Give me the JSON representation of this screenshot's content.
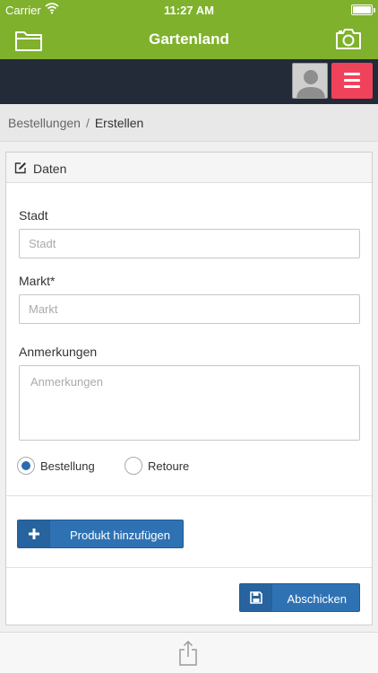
{
  "status_bar": {
    "carrier": "Carrier",
    "time": "11:27 AM",
    "battery_level": 1.0
  },
  "nav": {
    "title": "Gartenland",
    "left_icon": "folder-icon",
    "right_icon": "camera-icon"
  },
  "header": {
    "avatar_icon": "avatar-placeholder-icon",
    "menu_icon": "hamburger-icon"
  },
  "breadcrumb": {
    "parent": "Bestellungen",
    "separator": "/",
    "current": "Erstellen"
  },
  "panel": {
    "title": "Daten",
    "title_icon": "edit-icon",
    "fields": {
      "stadt": {
        "label": "Stadt",
        "placeholder": "Stadt",
        "value": ""
      },
      "markt": {
        "label": "Markt*",
        "placeholder": "Markt",
        "value": ""
      },
      "anmerkungen": {
        "label": "Anmerkungen",
        "placeholder": "Anmerkungen",
        "value": ""
      }
    },
    "order_type": {
      "options": [
        "Bestellung",
        "Retoure"
      ],
      "selected": "Bestellung"
    },
    "add_product_button": {
      "label": "Produkt hinzufügen",
      "icon": "plus-icon"
    },
    "submit_button": {
      "label": "Abschicken",
      "icon": "floppy-disk-icon"
    }
  },
  "bottom_bar": {
    "icon": "share-icon"
  },
  "colors": {
    "nav_green": "#7fb12c",
    "header_dark": "#232a38",
    "menu_red": "#f0425a",
    "primary_blue": "#2f72b3"
  }
}
